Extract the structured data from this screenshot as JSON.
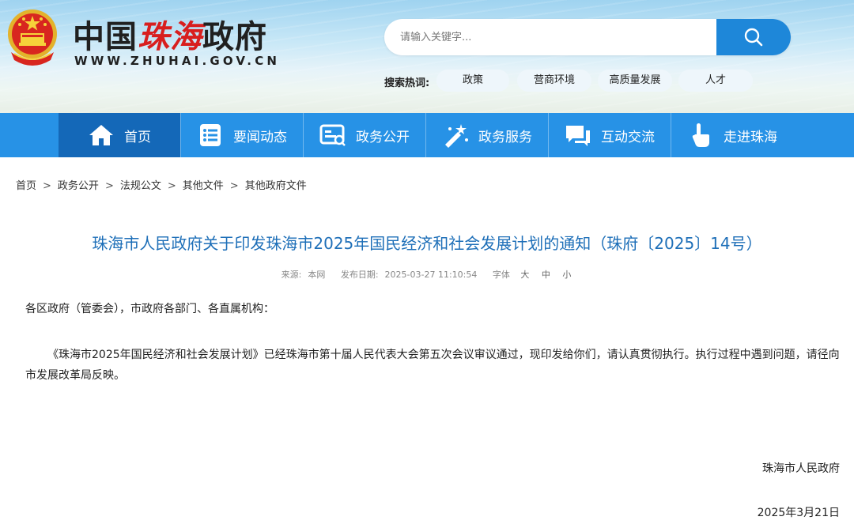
{
  "header": {
    "logo_cn_part1": "中国",
    "logo_cn_part2": "珠海",
    "logo_cn_part3": "政府",
    "logo_en": "WWW.ZHUHAI.GOV.CN"
  },
  "search": {
    "placeholder": "请输入关键字...",
    "hot_label": "搜索热词:",
    "hot_tags": [
      "政策",
      "营商环境",
      "高质量发展",
      "人才"
    ]
  },
  "nav": {
    "items": [
      {
        "label": "首页",
        "icon": "home-icon"
      },
      {
        "label": "要闻动态",
        "icon": "news-icon"
      },
      {
        "label": "政务公开",
        "icon": "document-icon"
      },
      {
        "label": "政务服务",
        "icon": "service-icon"
      },
      {
        "label": "互动交流",
        "icon": "chat-icon"
      },
      {
        "label": "走进珠海",
        "icon": "hand-icon"
      }
    ],
    "active_color": "#1468b8",
    "bar_color": "#2792e6"
  },
  "breadcrumb": [
    "首页",
    "政务公开",
    "法规公文",
    "其他文件",
    "其他政府文件"
  ],
  "article": {
    "title": "珠海市人民政府关于印发珠海市2025年国民经济和社会发展计划的通知（珠府〔2025〕14号）",
    "source_label": "来源:",
    "source": "本网",
    "date_label": "发布日期:",
    "publish_date": "2025-03-27 11:10:54",
    "font_label": "字体",
    "font_sizes": [
      "大",
      "中",
      "小"
    ],
    "salutation": "各区政府（管委会），市政府各部门、各直属机构：",
    "body": "《珠海市2025年国民经济和社会发展计划》已经珠海市第十届人民代表大会第五次会议审议通过，现印发给你们，请认真贯彻执行。执行过程中遇到问题，请径向市发展改革局反映。",
    "signer": "珠海市人民政府",
    "sign_date": "2025年3月21日"
  }
}
